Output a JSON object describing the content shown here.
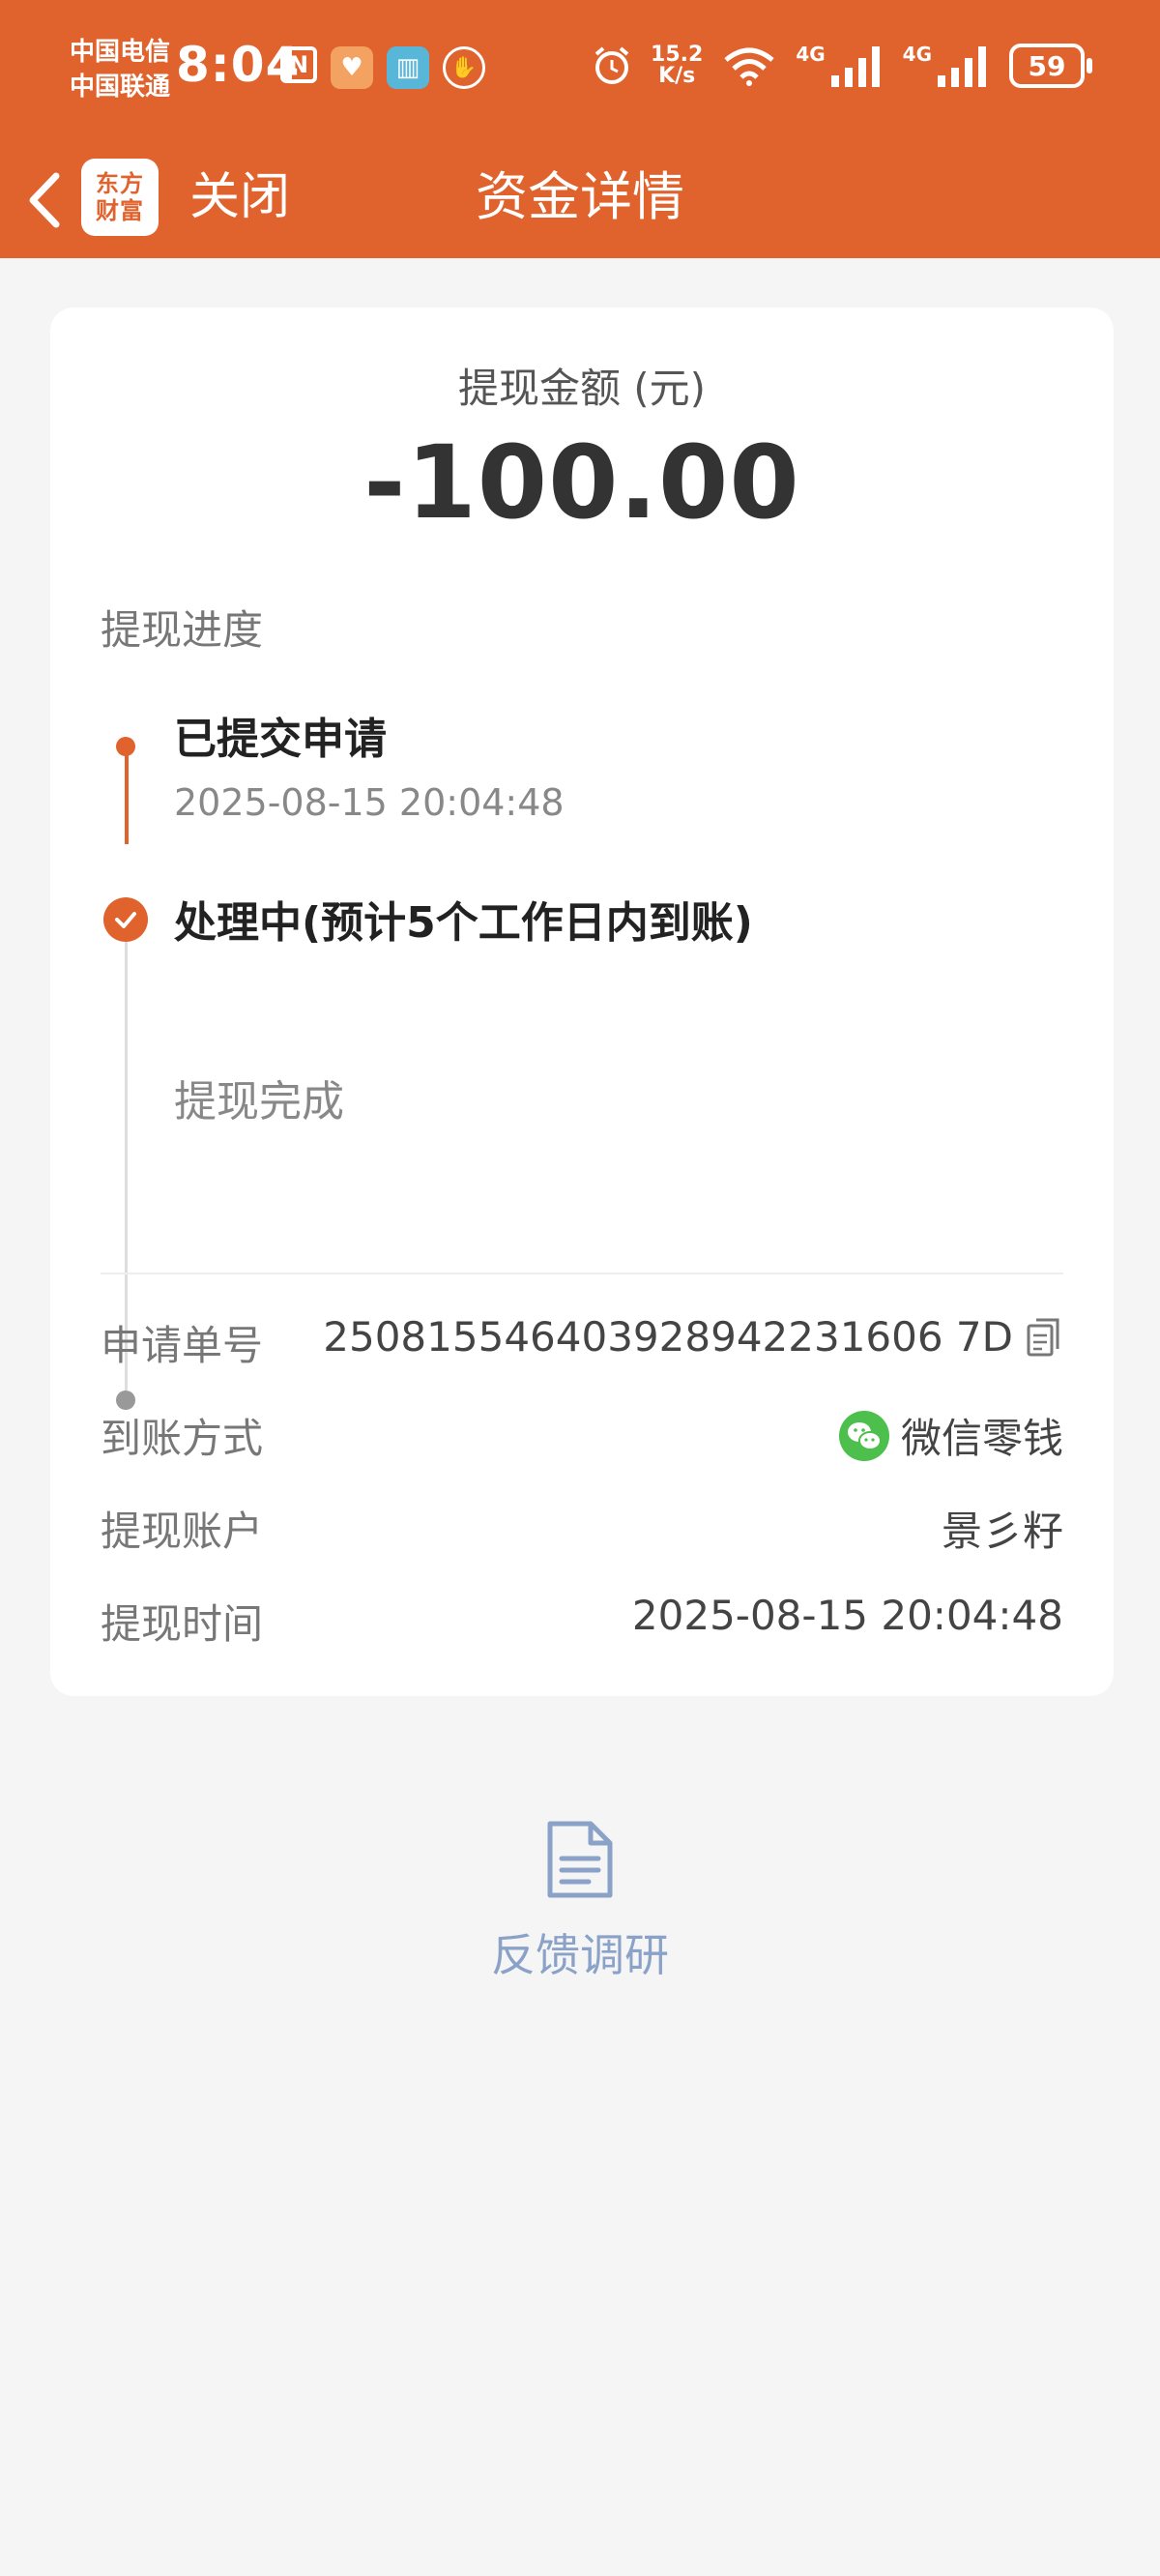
{
  "status_bar": {
    "carrier_1": "中国电信",
    "carrier_2": "中国联通",
    "time": "8:04",
    "net_speed_value": "15.2",
    "net_speed_unit": "K/s",
    "signal_1": "4G",
    "signal_2": "4G",
    "battery": "59"
  },
  "nav": {
    "logo_line1": "东方",
    "logo_line2": "财富",
    "close_label": "关闭",
    "title": "资金详情"
  },
  "amount": {
    "label": "提现金额 (元)",
    "value": "-100.00"
  },
  "progress": {
    "label": "提现进度",
    "steps": [
      {
        "title": "已提交申请",
        "time": "2025-08-15 20:04:48",
        "status": "done"
      },
      {
        "title": "处理中(预计5个工作日内到账)",
        "status": "current"
      },
      {
        "title": "提现完成",
        "status": "pending"
      }
    ]
  },
  "details": {
    "order_no_label": "申请单号",
    "order_no": "250815546403928942231606 7D",
    "method_label": "到账方式",
    "method": "微信零钱",
    "account_label": "提现账户",
    "account": "景彡籽",
    "time_label": "提现时间",
    "time": "2025-08-15 20:04:48"
  },
  "feedback": {
    "label": "反馈调研"
  },
  "colors": {
    "brand": "#e0622c",
    "feedback": "#8aa2c8",
    "wechat": "#4cbf4c"
  }
}
